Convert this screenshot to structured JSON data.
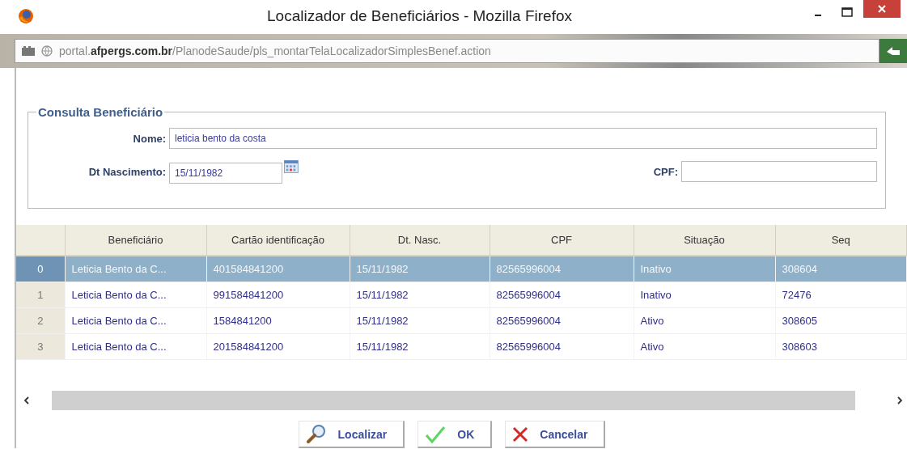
{
  "window": {
    "title": "Localizador de Beneficiários - Mozilla Firefox"
  },
  "address_bar": {
    "url": "portal.**afpergs.com.br**/PlanodeSaude/pls_montarTelaLocalizadorSimplesBenef.action"
  },
  "form": {
    "legend": "Consulta Beneficiário",
    "fields": [
      {
        "kind": "text",
        "label": "Nome:",
        "value": "leticia bento da costa"
      },
      {
        "kind": "date",
        "label": "Dt Nascimento:",
        "value": "15/11/1982"
      },
      {
        "kind": "text",
        "label": "CPF:"
      }
    ]
  },
  "table": {
    "columns": [
      "Beneficiário",
      "Cartão identificação",
      "Dt. Nasc.",
      "CPF",
      "Situação",
      "Seq"
    ],
    "rows": [
      {
        "index": "0",
        "selected": true,
        "cells": [
          "Leticia Bento da C...",
          "401584841200",
          "15/11/1982",
          "82565996004",
          "Inativo",
          "308604"
        ]
      },
      {
        "index": "1",
        "selected": false,
        "cells": [
          "Leticia Bento da C...",
          "991584841200",
          "15/11/1982",
          "82565996004",
          "Inativo",
          "72476"
        ]
      },
      {
        "index": "2",
        "selected": false,
        "cells": [
          "Leticia Bento da C...",
          "1584841200",
          "15/11/1982",
          "82565996004",
          "Ativo",
          "308605"
        ]
      },
      {
        "index": "3",
        "selected": false,
        "cells": [
          "Leticia Bento da C...",
          "201584841200",
          "15/11/1982",
          "82565996004",
          "Ativo",
          "308603"
        ]
      }
    ]
  },
  "buttons": [
    {
      "kind": "search",
      "label": "Localizar"
    },
    {
      "kind": "ok",
      "label": "OK"
    },
    {
      "kind": "cancel",
      "label": "Cancelar"
    }
  ]
}
